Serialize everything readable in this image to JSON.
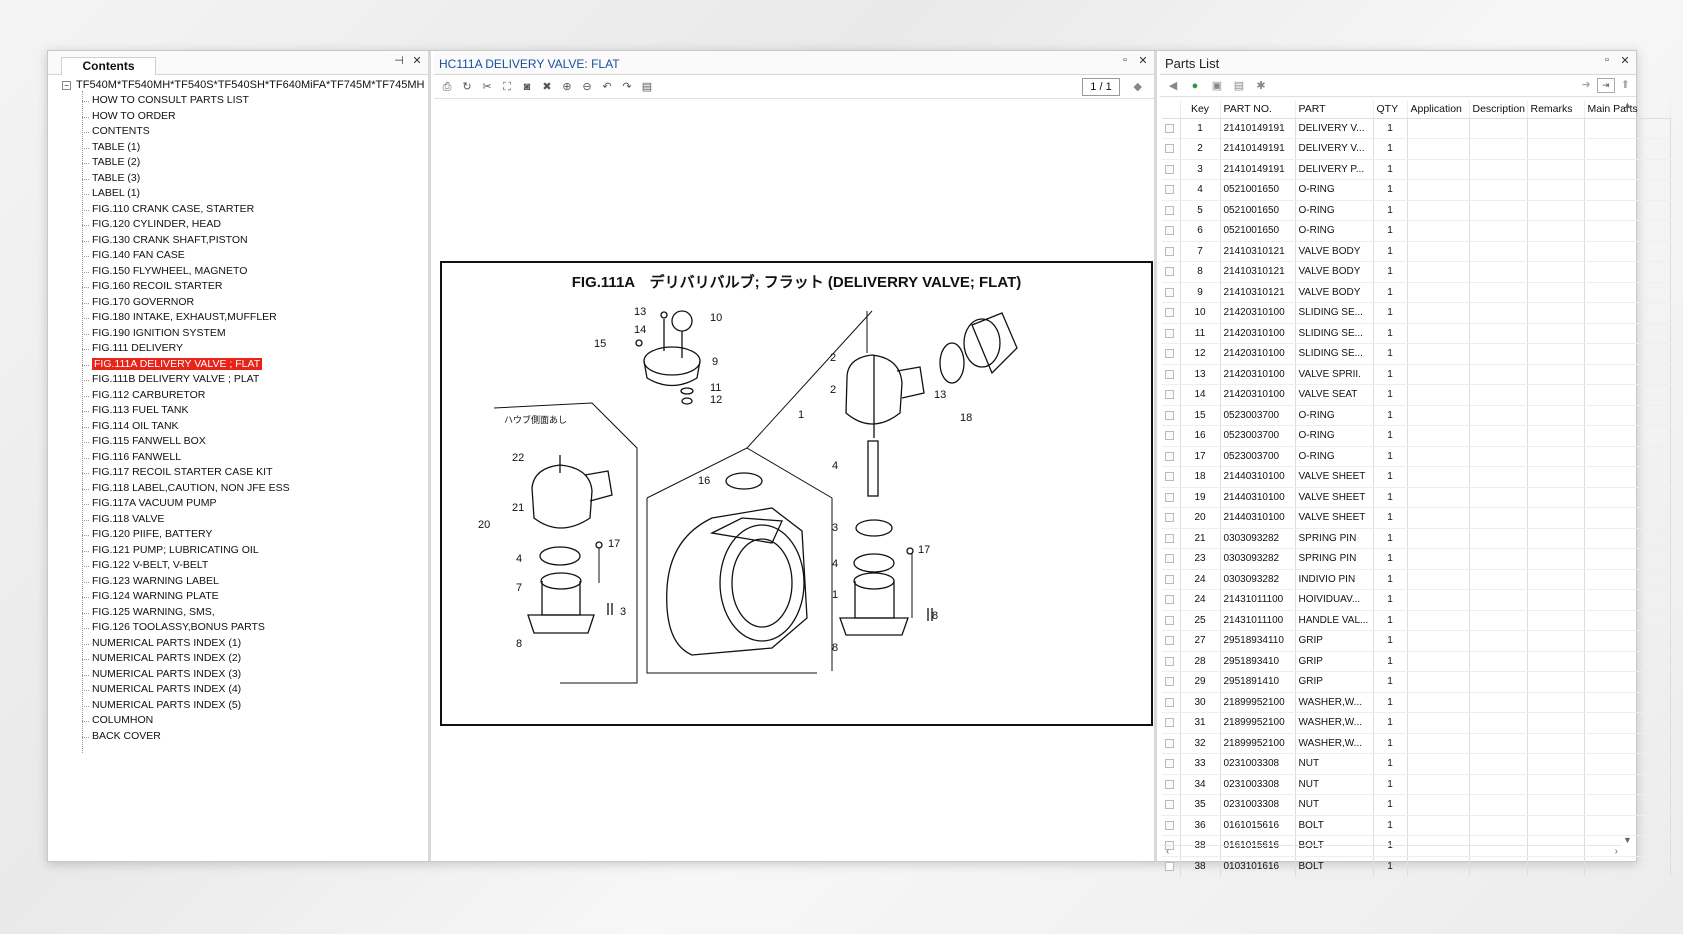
{
  "contents": {
    "tab_label": "Contents",
    "root": "TF540M*TF540MH*TF540S*TF540SH*TF640MiFA*TF745M*TF745MH",
    "items": [
      "HOW TO CONSULT PARTS LIST",
      "HOW TO ORDER",
      "CONTENTS",
      "TABLE (1)",
      "TABLE (2)",
      "TABLE (3)",
      "LABEL (1)",
      "FIG.110 CRANK CASE, STARTER",
      "FIG.120 CYLINDER, HEAD",
      "FIG.130 CRANK SHAFT,PISTON",
      "FIG.140 FAN CASE",
      "FIG.150 FLYWHEEL, MAGNETO",
      "FIG.160 RECOIL STARTER",
      "FIG.170 GOVERNOR",
      "FIG.180 INTAKE, EXHAUST,MUFFLER",
      "FIG.190 IGNITION SYSTEM",
      "FIG.111 DELIVERY",
      "FIG.111A DELIVERY VALVE ; FLAT",
      "FIG.111B DELIVERY VALVE ; PLAT",
      "FIG.112 CARBURETOR",
      "FIG.113 FUEL TANK",
      "FIG.114 OIL TANK",
      "FIG.115 FANWELL BOX",
      "FIG.116 FANWELL",
      "FIG.117 RECOIL STARTER CASE KIT",
      "FIG.118 LABEL,CAUTION, NON JFE ESS",
      "FIG.117A VACUUM PUMP",
      "FIG.118 VALVE",
      "FIG.120 PIIFE, BATTERY",
      "FIG.121 PUMP; LUBRICATING OIL",
      "FIG.122 V-BELT, V-BELT",
      "FIG.123 WARNING LABEL",
      "FIG.124 WARNING PLATE",
      "FIG.125 WARNING, SMS,",
      "FIG.126 TOOLASSY,BONUS PARTS",
      "NUMERICAL PARTS INDEX (1)",
      "NUMERICAL PARTS INDEX (2)",
      "NUMERICAL PARTS INDEX (3)",
      "NUMERICAL PARTS INDEX (4)",
      "NUMERICAL PARTS INDEX (5)",
      "COLUMHON",
      "BACK COVER"
    ],
    "selected_index": 17
  },
  "viewer": {
    "title": "HC111A DELIVERY VALVE: FLAT",
    "page_indicator": "1 / 1",
    "drawing_title": "FIG.111A　デリバリバルブ; フラット (DELIVERRY VALVE; FLAT)",
    "drawing_subtitle": "ハウブ側面あし",
    "callouts": [
      "13",
      "10",
      "14",
      "15",
      "9",
      "11",
      "12",
      "2",
      "2",
      "1",
      "13",
      "18",
      "22",
      "16",
      "21",
      "20",
      "4",
      "17",
      "7",
      "3",
      "8",
      "4",
      "3",
      "4",
      "1",
      "17",
      "8",
      "8"
    ]
  },
  "parts": {
    "title": "Parts List",
    "columns": [
      "Key",
      "PART NO.",
      "PART",
      "QTY",
      "Application",
      "Description",
      "Remarks",
      "Main Parts"
    ],
    "rows": [
      [
        "1",
        "21410149191",
        "DELIVERY V...",
        "1"
      ],
      [
        "2",
        "21410149191",
        "DELIVERY V...",
        "1"
      ],
      [
        "3",
        "21410149191",
        "DELIVERY P...",
        "1"
      ],
      [
        "4",
        "0521001650",
        "O-RING",
        "1"
      ],
      [
        "5",
        "0521001650",
        "O-RING",
        "1"
      ],
      [
        "6",
        "0521001650",
        "O-RING",
        "1"
      ],
      [
        "7",
        "21410310121",
        "VALVE BODY",
        "1"
      ],
      [
        "8",
        "21410310121",
        "VALVE BODY",
        "1"
      ],
      [
        "9",
        "21410310121",
        "VALVE BODY",
        "1"
      ],
      [
        "10",
        "21420310100",
        "SLIDING SE...",
        "1"
      ],
      [
        "11",
        "21420310100",
        "SLIDING SE...",
        "1"
      ],
      [
        "12",
        "21420310100",
        "SLIDING SE...",
        "1"
      ],
      [
        "13",
        "21420310100",
        "VALVE SPRII.",
        "1"
      ],
      [
        "14",
        "21420310100",
        "VALVE SEAT",
        "1"
      ],
      [
        "15",
        "0523003700",
        "O-RING",
        "1"
      ],
      [
        "16",
        "0523003700",
        "O-RING",
        "1"
      ],
      [
        "17",
        "0523003700",
        "O-RING",
        "1"
      ],
      [
        "18",
        "21440310100",
        "VALVE SHEET",
        "1"
      ],
      [
        "19",
        "21440310100",
        "VALVE SHEET",
        "1"
      ],
      [
        "20",
        "21440310100",
        "VALVE SHEET",
        "1"
      ],
      [
        "21",
        "0303093282",
        "SPRING PIN",
        "1"
      ],
      [
        "23",
        "0303093282",
        "SPRING PIN",
        "1"
      ],
      [
        "24",
        "0303093282",
        "INDIVIO PIN",
        "1"
      ],
      [
        "24",
        "21431011100",
        "HOIVIDUAV...",
        "1"
      ],
      [
        "25",
        "21431011100",
        "HANDLE VAL...",
        "1"
      ],
      [
        "27",
        "29518934110",
        "GRIP",
        "1"
      ],
      [
        "28",
        "2951893410",
        "GRIP",
        "1"
      ],
      [
        "29",
        "2951891410",
        "GRIP",
        "1"
      ],
      [
        "30",
        "21899952100",
        "WASHER,W...",
        "1"
      ],
      [
        "31",
        "21899952100",
        "WASHER,W...",
        "1"
      ],
      [
        "32",
        "21899952100",
        "WASHER,W...",
        "1"
      ],
      [
        "33",
        "0231003308",
        "NUT",
        "1"
      ],
      [
        "34",
        "0231003308",
        "NUT",
        "1"
      ],
      [
        "35",
        "0231003308",
        "NUT",
        "1"
      ],
      [
        "36",
        "0161015616",
        "BOLT",
        "1"
      ],
      [
        "38",
        "0161015616",
        "BOLT",
        "1"
      ],
      [
        "38",
        "0103101616",
        "BOLT",
        "1"
      ]
    ]
  },
  "colors": {
    "selection": "#e8241a",
    "link": "#1a4fa0",
    "go": "#2a9a3a"
  }
}
